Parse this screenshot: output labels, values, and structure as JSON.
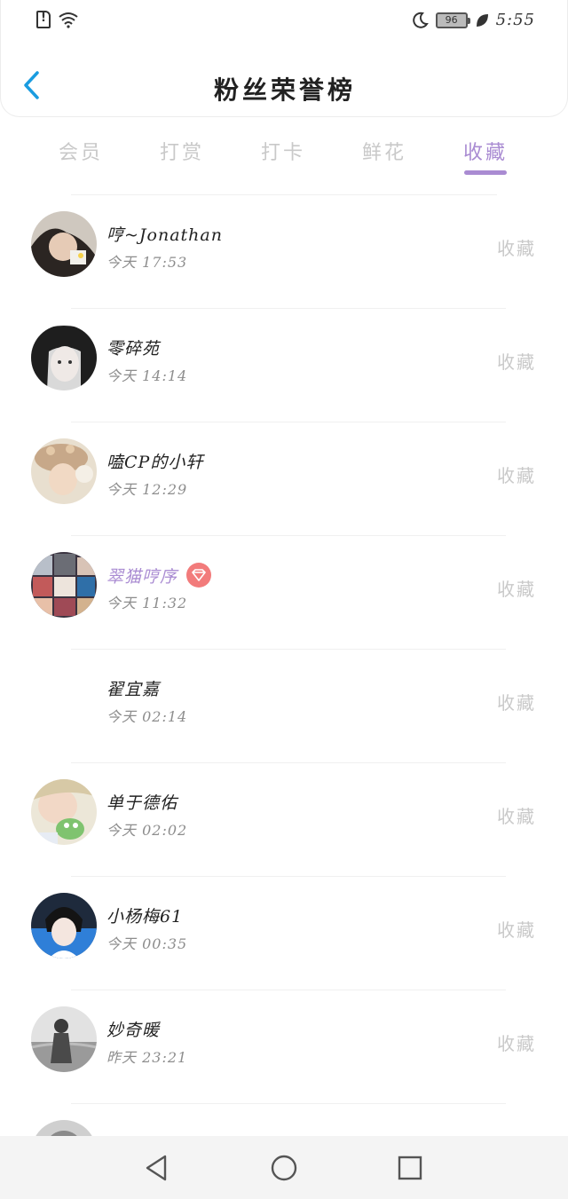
{
  "status_bar": {
    "time": "5:55",
    "battery": "96",
    "icons": [
      "sim-alert-icon",
      "wifi-icon",
      "moon-icon",
      "battery-icon",
      "leaf-icon"
    ]
  },
  "header": {
    "title": "粉丝荣誉榜",
    "back_icon": "chevron-left-icon"
  },
  "tabs": [
    {
      "label": "会员",
      "active": false
    },
    {
      "label": "打赏",
      "active": false
    },
    {
      "label": "打卡",
      "active": false
    },
    {
      "label": "鲜花",
      "active": false
    },
    {
      "label": "收藏",
      "active": true
    }
  ],
  "colors": {
    "accent": "#a98bd2",
    "vip_badge": "#f27b7b",
    "back_icon": "#1a9ce0",
    "muted_text": "#c9c9c9"
  },
  "fans": [
    {
      "name": "哼~Jonathan",
      "time": "今天 17:53",
      "action": "收藏",
      "vip": false
    },
    {
      "name": "零碎苑",
      "time": "今天 14:14",
      "action": "收藏",
      "vip": false
    },
    {
      "name": "嗑CP的小轩",
      "time": "今天 12:29",
      "action": "收藏",
      "vip": false
    },
    {
      "name": "翠猫哼序",
      "time": "今天 11:32",
      "action": "收藏",
      "vip": true
    },
    {
      "name": "翟宜嘉",
      "time": "今天 02:14",
      "action": "收藏",
      "vip": false
    },
    {
      "name": "单于德佑",
      "time": "今天 02:02",
      "action": "收藏",
      "vip": false
    },
    {
      "name": "小杨梅61",
      "time": "今天 00:35",
      "action": "收藏",
      "vip": false
    },
    {
      "name": "妙奇暖",
      "time": "昨天 23:21",
      "action": "收藏",
      "vip": false
    },
    {
      "name": "",
      "time": "",
      "action": "",
      "vip": false
    }
  ],
  "system_nav": [
    "back-triangle-icon",
    "home-circle-icon",
    "recent-square-icon"
  ]
}
